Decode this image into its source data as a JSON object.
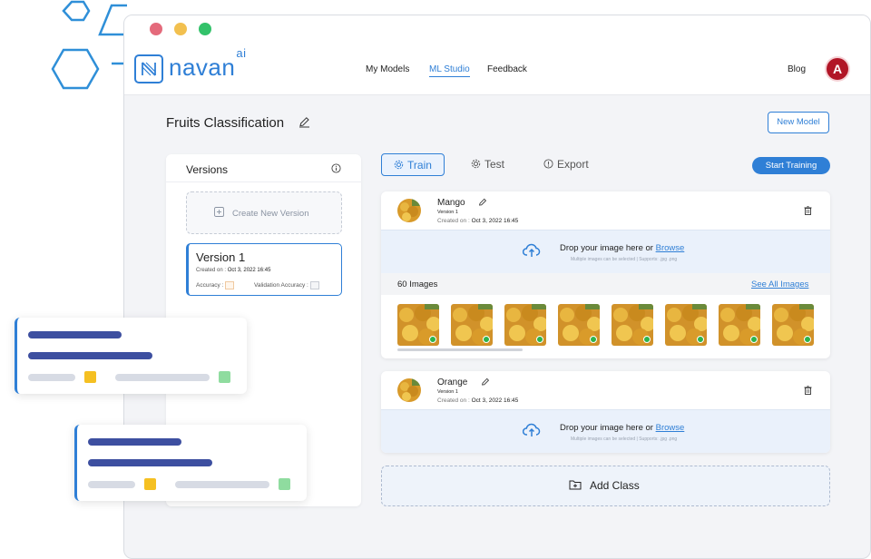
{
  "app": {
    "brand": "navan",
    "brand_sup": "ai",
    "nav": [
      "My Models",
      "ML Studio",
      "Feedback"
    ],
    "active_nav": "ML Studio",
    "blog": "Blog",
    "avatar_letter": "A",
    "accent": "#2f7fd6"
  },
  "page": {
    "title": "Fruits Classification",
    "new_model": "New Model"
  },
  "versions": {
    "title": "Versions",
    "create_label": "Create New Version",
    "items": [
      {
        "name": "Version 1",
        "created_label": "Created on :",
        "created_value": "Oct 3, 2022   16:45",
        "accuracy_label": "Accuracy :",
        "validation_label": "Validation Accuracy :"
      }
    ]
  },
  "tabs": [
    "Train",
    "Test",
    "Export"
  ],
  "active_tab": "Train",
  "start_training": "Start Training",
  "classes": [
    {
      "name": "Mango",
      "version": "Version 1",
      "created_label": "Created on :",
      "created_value": "Oct 3, 2022   16:45",
      "drop_text": "Drop your image here or",
      "browse": "Browse",
      "drop_sub": "Multiple images can be selected | Supports: .jpg .png",
      "image_count": "60 Images",
      "see_all": "See All Images"
    },
    {
      "name": "Orange",
      "version": "Version 1",
      "created_label": "Created on :",
      "created_value": "Oct 3, 2022   16:45",
      "drop_text": "Drop your image here or",
      "browse": "Browse",
      "drop_sub": "Multiple images can be selected | Supports: .jpg .png"
    }
  ],
  "add_class": "Add Class"
}
